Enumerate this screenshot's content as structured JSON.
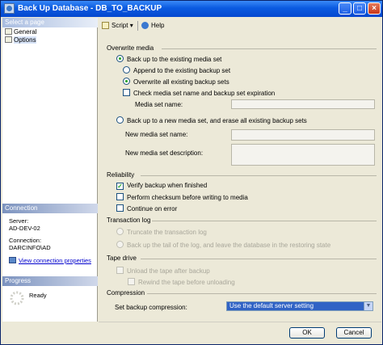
{
  "window": {
    "title": "Back Up Database - DB_TO_BACKUP"
  },
  "left": {
    "select_page_header": "Select a page",
    "pages": [
      {
        "label": "General"
      },
      {
        "label": "Options"
      }
    ],
    "connection_header": "Connection",
    "server_label": "Server:",
    "server_value": "AD-DEV-02",
    "connection_label": "Connection:",
    "connection_value": "DARCINFO\\AD",
    "view_props_link": "View connection properties",
    "progress_header": "Progress",
    "progress_status": "Ready"
  },
  "toolbar": {
    "script_label": "Script",
    "help_label": "Help"
  },
  "overwrite": {
    "title": "Overwrite media",
    "existing_set": "Back up to the existing media set",
    "append": "Append to the existing backup set",
    "overwrite_all": "Overwrite all existing backup sets",
    "check_name": "Check media set name and backup set expiration",
    "media_set_name_label": "Media set name:",
    "new_set": "Back up to a new media set, and erase all existing backup sets",
    "new_name_label": "New media set name:",
    "new_desc_label": "New media set description:"
  },
  "reliability": {
    "title": "Reliability",
    "verify": "Verify backup when finished",
    "checksum": "Perform checksum before writing to media",
    "continue_error": "Continue on error"
  },
  "tlog": {
    "title": "Transaction log",
    "truncate": "Truncate the transaction log",
    "tail": "Back up the tail of the log, and leave the database in the restoring state"
  },
  "tape": {
    "title": "Tape drive",
    "unload": "Unload the tape after backup",
    "rewind": "Rewind the tape before unloading"
  },
  "compression": {
    "title": "Compression",
    "label": "Set backup compression:",
    "value": "Use the default server setting"
  },
  "buttons": {
    "ok": "OK",
    "cancel": "Cancel"
  },
  "colors": {
    "title_bar": "#0a5ae0",
    "selection": "#3163c5",
    "check_green": "#21a121"
  }
}
